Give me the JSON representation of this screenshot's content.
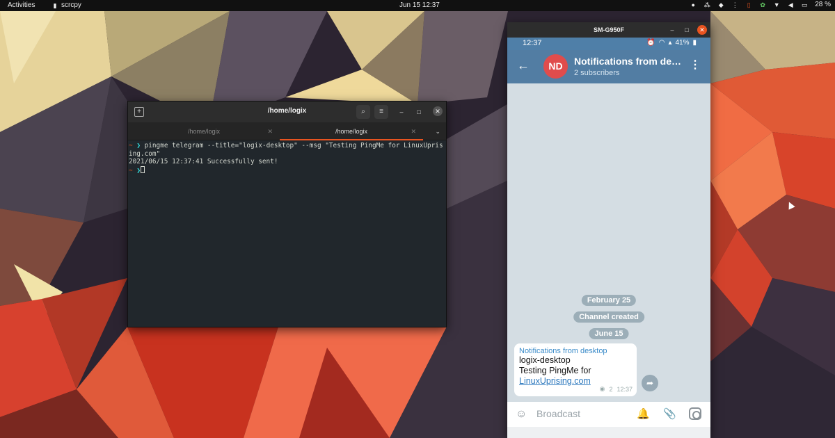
{
  "topbar": {
    "activities": "Activities",
    "app_name": "scrcpy",
    "clock": "Jun 15  12:37",
    "battery": "28 %"
  },
  "terminal": {
    "title": "/home/logix",
    "tabs": [
      {
        "label": "/home/logix",
        "active": false
      },
      {
        "label": "/home/logix",
        "active": true
      }
    ],
    "lines": {
      "prompt_tilde": "~",
      "prompt_arrow": "❯",
      "command": "pingme telegram --title=\"logix-desktop\" --msg \"Testing PingMe for LinuxUprising.com\"",
      "output": "2021/06/15 12:37:41 Successfully sent!"
    }
  },
  "scrcpy": {
    "window_title": "SM-G950F",
    "status_time": "12:37",
    "status_battery": "41%",
    "channel": {
      "avatar_initials": "ND",
      "name": "Notifications from desktop",
      "subscribers": "2 subscribers"
    },
    "service_messages": [
      "February 25",
      "Channel created",
      "June 15"
    ],
    "message": {
      "channel_name": "Notifications from desktop",
      "line1": "logix-desktop",
      "line2": "Testing PingMe for",
      "link": "LinuxUprising.com",
      "views": "2",
      "time": "12:37"
    },
    "compose_placeholder": "Broadcast"
  },
  "colors": {
    "terminal_accent": "#e95420",
    "telegram_header": "#527da3",
    "avatar": "#e04c4c"
  }
}
